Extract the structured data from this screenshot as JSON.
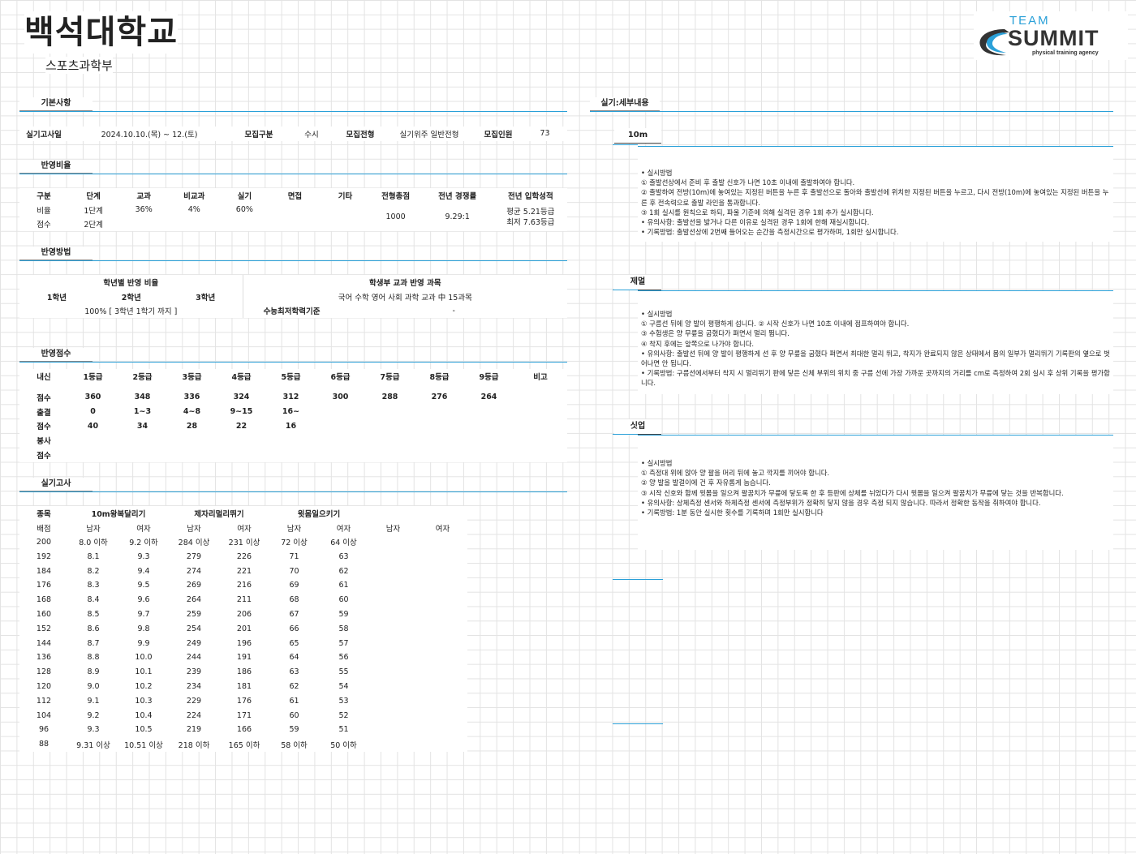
{
  "header": {
    "university": "백석대학교",
    "department": "스포츠과학부",
    "logo": {
      "line1": "TEAM",
      "line2": "SUMMIT",
      "line3": "physical training agency",
      "icon": "swoosh-icon",
      "color": "#2aa0d8"
    }
  },
  "sections": {
    "basic": "기본사항",
    "ratio": "반영비율",
    "method": "반영방법",
    "score": "반영점수",
    "practical": "실기고사",
    "detail": "실기:세부내용"
  },
  "basic": {
    "date_label": "실기고사일",
    "date_value": "2024.10.10.(목) ~ 12.(토)",
    "type_label": "모집구분",
    "type_value": "수시",
    "track_label": "모집전형",
    "track_value": "실기위주 일반전형",
    "quota_label": "모집인원",
    "quota_value": "73"
  },
  "ratio": {
    "headers": [
      "구분",
      "단계",
      "교과",
      "비교과",
      "실기",
      "면접",
      "기타",
      "전형총점",
      "전년 경쟁률",
      "전년 입학성적"
    ],
    "row1": [
      "비율",
      "1단계",
      "36%",
      "4%",
      "60%"
    ],
    "row2": [
      "점수",
      "2단계"
    ],
    "total": "1000",
    "competition": "9.29:1",
    "grade_avg": "평균 5.21등급",
    "grade_min": "최저 7.63등급"
  },
  "method": {
    "year_title": "학년별 반영 비율",
    "years": [
      "1학년",
      "2학년",
      "3학년"
    ],
    "year_value": "100% [ 3학년 1학기 까지 ]",
    "subject_title": "학생부 교과 반영 과목",
    "subject_value": "국어 수학 영어 사회 과학 교과 中 15과목",
    "min_label": "수능최저학력기준",
    "min_value": "-"
  },
  "score": {
    "headers": [
      "내신",
      "1등급",
      "2등급",
      "3등급",
      "4등급",
      "5등급",
      "6등급",
      "7등급",
      "8등급",
      "9등급",
      "비고"
    ],
    "grade_row": [
      "점수",
      "360",
      "348",
      "336",
      "324",
      "312",
      "300",
      "288",
      "276",
      "264"
    ],
    "attend_row": [
      "출결",
      "0",
      "1~3",
      "4~8",
      "9~15",
      "16~"
    ],
    "attend_score_row": [
      "점수",
      "40",
      "34",
      "28",
      "22",
      "16"
    ],
    "volunteer_row": [
      "봉사"
    ],
    "volunteer_score_row": [
      "점수"
    ]
  },
  "practical": {
    "col_label": "종목",
    "events": [
      "10m왕복달리기",
      "제자리멀리뛰기",
      "윗몸일으키기"
    ],
    "sub_headers": [
      "배점",
      "남자",
      "여자",
      "남자",
      "여자",
      "남자",
      "여자",
      "남자",
      "여자"
    ],
    "rows": [
      [
        "200",
        "8.0 이하",
        "9.2 이하",
        "284 이상",
        "231 이상",
        "72 이상",
        "64 이상"
      ],
      [
        "192",
        "8.1",
        "9.3",
        "279",
        "226",
        "71",
        "63"
      ],
      [
        "184",
        "8.2",
        "9.4",
        "274",
        "221",
        "70",
        "62"
      ],
      [
        "176",
        "8.3",
        "9.5",
        "269",
        "216",
        "69",
        "61"
      ],
      [
        "168",
        "8.4",
        "9.6",
        "264",
        "211",
        "68",
        "60"
      ],
      [
        "160",
        "8.5",
        "9.7",
        "259",
        "206",
        "67",
        "59"
      ],
      [
        "152",
        "8.6",
        "9.8",
        "254",
        "201",
        "66",
        "58"
      ],
      [
        "144",
        "8.7",
        "9.9",
        "249",
        "196",
        "65",
        "57"
      ],
      [
        "136",
        "8.8",
        "10.0",
        "244",
        "191",
        "64",
        "56"
      ],
      [
        "128",
        "8.9",
        "10.1",
        "239",
        "186",
        "63",
        "55"
      ],
      [
        "120",
        "9.0",
        "10.2",
        "234",
        "181",
        "62",
        "54"
      ],
      [
        "112",
        "9.1",
        "10.3",
        "229",
        "176",
        "61",
        "53"
      ],
      [
        "104",
        "9.2",
        "10.4",
        "224",
        "171",
        "60",
        "52"
      ],
      [
        "96",
        "9.3",
        "10.5",
        "219",
        "166",
        "59",
        "51"
      ],
      [
        "88",
        "9.31 이상",
        "10.51 이상",
        "218 이하",
        "165 이하",
        "58 이하",
        "50 이하"
      ]
    ]
  },
  "details": [
    {
      "name": "10m",
      "lines": [
        "• 실시방법",
        "① 출발선상에서 준비 후 출발 신호가 나면 10초 이내에 출발하여야 합니다.",
        "② 출발하여 전방(10m)에 놓여있는 지정된 버튼을 누른 후 출발선으로 돌아와 출발선에 위치한 지정된 버튼을 누르고, 다시 전방(10m)에 놓여있는 지정된 버튼을 누른 후 전속력으로 출발 라인을 통과합니다.",
        "③ 1회 실시를 원칙으로 하되, 파울 기준에 의해 실격된 경우 1회 추가 실시합니다.",
        "• 유의사항: 출발선을 밟거나 다른 이유로 실격된 경우 1회에 한해 재실시합니다.",
        "• 기록방법: 출발선상에 2번째 들어오는 순간을 측정시간으로 평가하며, 1회만 실시합니다."
      ]
    },
    {
      "name": "제멀",
      "lines": [
        "• 실시방법",
        "① 구름선 뒤에 양 발이 평행하게 섭니다. ② 시작 신호가 나면 10초 이내에 점프하여야 합니다.",
        "③ 수험생은 양 무릎을 굽혔다가 펴면서 멀리 뜁니다.",
        "④ 착지 후에는 앞쪽으로 나가야 합니다.",
        "• 유의사항: 출발선 뒤에 양 발이 평행하게 선 후 양 무릎을 굽혔다 펴면서 최대한 멀리 뛰고, 착지가 완료되지 않은 상태에서 몸의 일부가 멀리뛰기 기록판의 옆으로 벗어나면 안 됩니다.",
        "• 기록방법: 구름선에서부터 착지 시 멀리뛰기 판에 닿은 신체 부위의 위치 중 구름 선에 가장 가까운 곳까지의 거리를 cm로 측정하여 2회 실시 후 상위 기록을 평가합니다."
      ]
    },
    {
      "name": "싯업",
      "lines": [
        "• 실시방법",
        "① 측정대 위에 앉아 양 팔을 머리 뒤에 놓고 깍지를 끼어야 합니다.",
        "② 양 발을 발걸이에 건 후 자유롭게 눕습니다.",
        "③ 시작 신호와 함께 윗몸을 일으켜 팔꿈치가 무릎에 닿도록 한 후 등판에 상체를 뉘었다가 다시 윗몸을 일으켜 팔꿈치가 무릎에 닿는 것을 반복합니다.",
        "• 유의사항: 상체측정 센서와 하체측정 센서에 측정부위가 정확히 닿지 않을 경우 측정 되지 않습니다. 따라서 정확한 동작을 취하여야 합니다.",
        "• 기록방법: 1분 동안 실시한 횟수를 기록하며 1회만 실시합니다"
      ]
    }
  ]
}
